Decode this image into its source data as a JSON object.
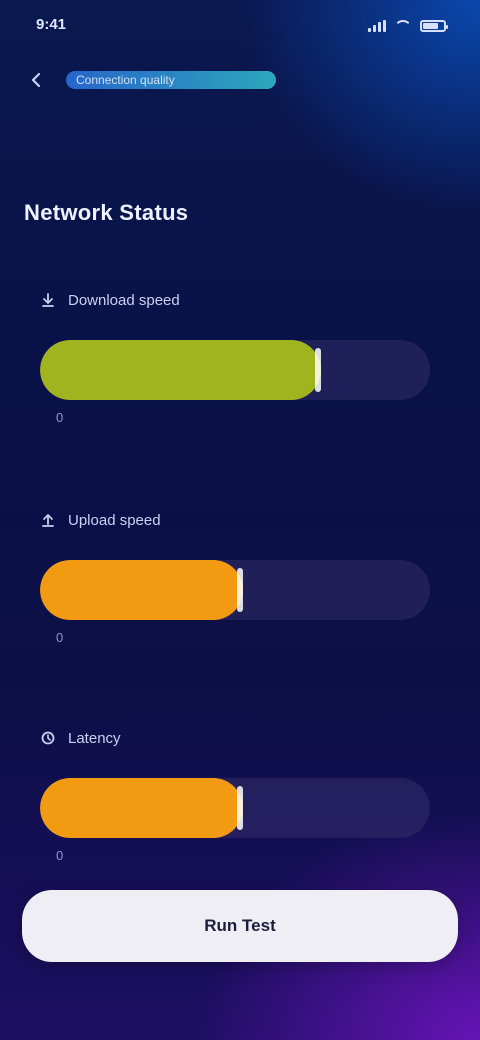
{
  "status_bar": {
    "time": "9:41",
    "icons": [
      "signal-icon",
      "wifi-icon",
      "battery-icon"
    ]
  },
  "nav": {
    "back_icon": "arrow-left-icon",
    "title": "Connection quality"
  },
  "section": {
    "title": "Network Status"
  },
  "metrics": [
    {
      "icon": "download-icon",
      "label": "Download speed",
      "min_label": "0",
      "value_label": "",
      "max_label": "",
      "level": 0.72,
      "color": "#9fb41e"
    },
    {
      "icon": "upload-icon",
      "label": "Upload speed",
      "min_label": "0",
      "value_label": "",
      "max_label": "",
      "level": 0.52,
      "color": "#f29a12"
    },
    {
      "icon": "ping-icon",
      "label": "Latency",
      "min_label": "0",
      "value_label": "",
      "max_label": "",
      "level": 0.52,
      "color": "#f29a12"
    }
  ],
  "cta": {
    "label": "Run Test"
  }
}
